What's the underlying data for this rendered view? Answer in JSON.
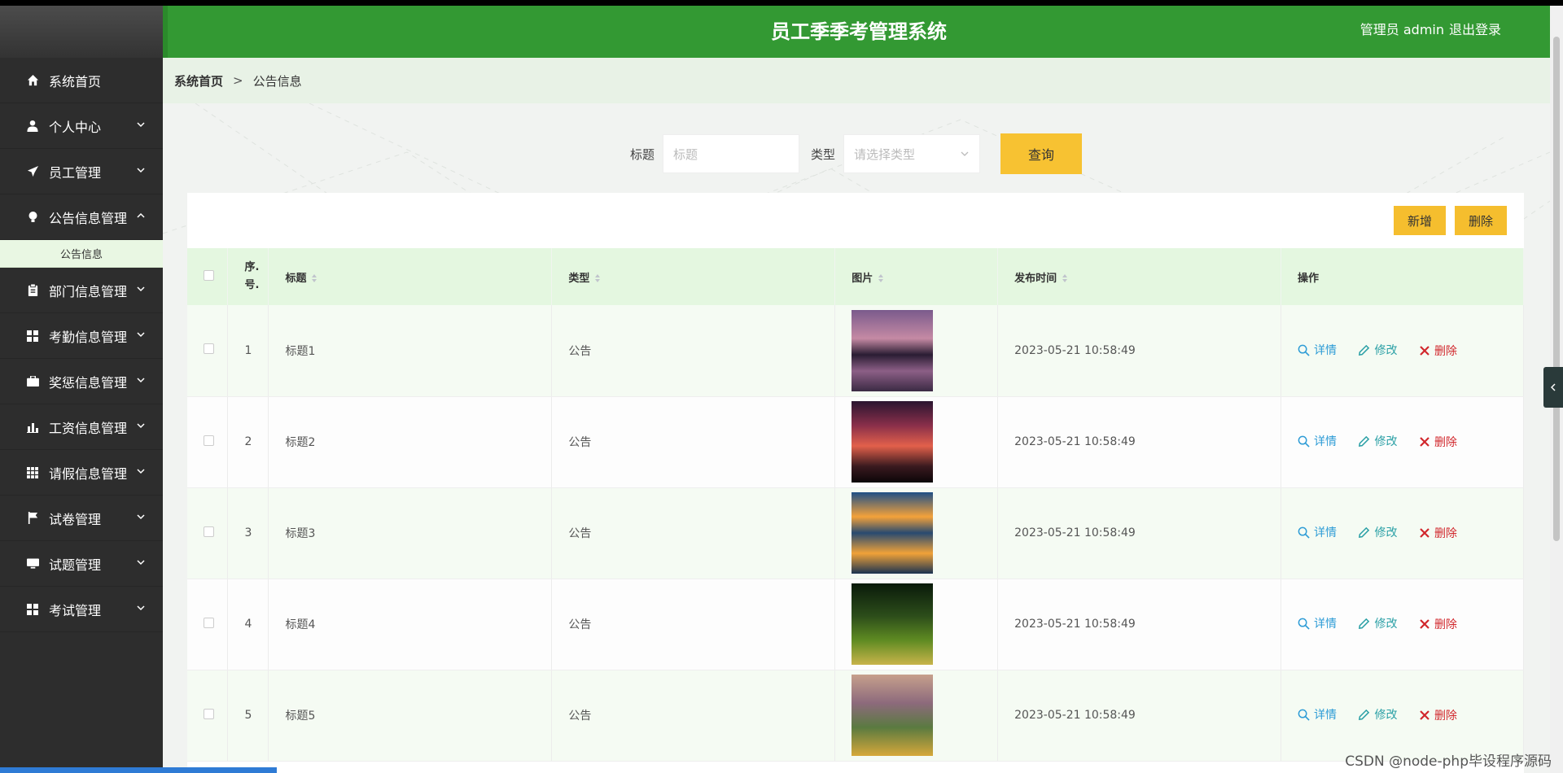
{
  "header": {
    "title": "员工季季考管理系统",
    "user": "管理员 admin",
    "logout": "退出登录"
  },
  "breadcrumb": {
    "home": "系统首页",
    "separator": ">",
    "current": "公告信息"
  },
  "sidebar": {
    "items": [
      {
        "label": "系统首页",
        "icon": "home-icon",
        "has_children": false
      },
      {
        "label": "个人中心",
        "icon": "user-icon",
        "has_children": true
      },
      {
        "label": "员工管理",
        "icon": "paper-plane-icon",
        "has_children": true
      },
      {
        "label": "公告信息管理",
        "icon": "lightbulb-icon",
        "has_children": true,
        "expanded": true
      },
      {
        "label": "部门信息管理",
        "icon": "clipboard-icon",
        "has_children": true
      },
      {
        "label": "考勤信息管理",
        "icon": "grid-icon",
        "has_children": true
      },
      {
        "label": "奖惩信息管理",
        "icon": "briefcase-icon",
        "has_children": true
      },
      {
        "label": "工资信息管理",
        "icon": "bar-chart-icon",
        "has_children": true
      },
      {
        "label": "请假信息管理",
        "icon": "table-icon",
        "has_children": true
      },
      {
        "label": "试卷管理",
        "icon": "flag-icon",
        "has_children": true
      },
      {
        "label": "试题管理",
        "icon": "monitor-icon",
        "has_children": true
      },
      {
        "label": "考试管理",
        "icon": "grid-icon",
        "has_children": true
      }
    ],
    "subitem": "公告信息"
  },
  "search": {
    "title_label": "标题",
    "title_placeholder": "标题",
    "type_label": "类型",
    "type_placeholder": "请选择类型",
    "query_button": "查询"
  },
  "toolbar": {
    "add_button": "新增",
    "delete_button": "删除"
  },
  "table": {
    "columns": [
      "序.\n号.",
      "标题",
      "类型",
      "图片",
      "发布时间",
      "操作"
    ],
    "col_index": "序.",
    "col_index2": "号.",
    "col_title": "标题",
    "col_type": "类型",
    "col_image": "图片",
    "col_time": "发布时间",
    "col_ops": "操作",
    "rows": [
      {
        "index": "1",
        "title": "标题1",
        "type": "公告",
        "time": "2023-05-21 10:58:49",
        "image": "mountain-lake-sunset"
      },
      {
        "index": "2",
        "title": "标题2",
        "type": "公告",
        "time": "2023-05-21 10:58:49",
        "image": "red-sunset-trees"
      },
      {
        "index": "3",
        "title": "标题3",
        "type": "公告",
        "time": "2023-05-21 10:58:49",
        "image": "sunset-lake-reflection"
      },
      {
        "index": "4",
        "title": "标题4",
        "type": "公告",
        "time": "2023-05-21 10:58:49",
        "image": "tree-lined-road"
      },
      {
        "index": "5",
        "title": "标题5",
        "type": "公告",
        "time": "2023-05-21 10:58:49",
        "image": "flower-field-mountains"
      }
    ],
    "op_detail": "详情",
    "op_edit": "修改",
    "op_delete": "删除"
  },
  "watermark": "CSDN @node-php毕设程序源码",
  "colors": {
    "header_green": "#339933",
    "sidebar_dark": "#2d2d2d",
    "accent_yellow": "#f7c232",
    "table_head": "#e4f7e0"
  }
}
